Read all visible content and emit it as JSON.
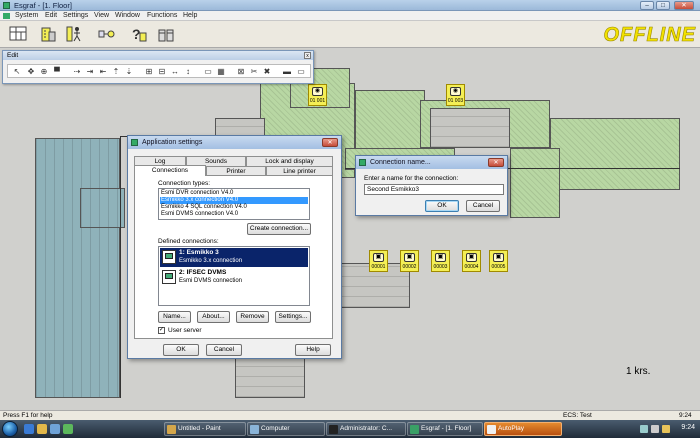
{
  "window": {
    "title": "Esgraf - [1. Floor]",
    "controls": {
      "minimize": "–",
      "maximize": "□",
      "close": "✕"
    }
  },
  "menubar": [
    "System",
    "Edit",
    "Settings",
    "View",
    "Window",
    "Functions",
    "Help"
  ],
  "toolbar_icons": [
    "floorplan-icon",
    "building-icon",
    "user-walk-icon",
    "key-icon",
    "help-icon",
    "toolbox-icon"
  ],
  "offline_label": "OFFLINE",
  "edit_toolbar": {
    "title": "Edit",
    "close": "x",
    "tools": [
      "↖",
      "✥",
      "⊕",
      "▀",
      "⇢",
      "⇥",
      "⇤",
      "⇡",
      "⇣",
      "⊞",
      "⊟",
      "↔",
      "↕",
      "▭",
      "▦",
      "⊠",
      "✂",
      "✖",
      "▬",
      "▭"
    ]
  },
  "devices": [
    {
      "id": "01 001",
      "glyph": "◉"
    },
    {
      "id": "01 003",
      "glyph": "◉"
    },
    {
      "id": "00001",
      "glyph": "▣"
    },
    {
      "id": "00002",
      "glyph": "▣"
    },
    {
      "id": "00003",
      "glyph": "▣"
    },
    {
      "id": "00004",
      "glyph": "▣"
    },
    {
      "id": "00005",
      "glyph": "▣"
    }
  ],
  "scale_label": "1 krs.",
  "app_settings": {
    "title": "Application settings",
    "tabs_row1": [
      "Log",
      "Sounds",
      "Lock and display"
    ],
    "tabs_row2": [
      "Connections",
      "Printer",
      "Line printer"
    ],
    "active_tab": "Connections",
    "connection_types_label": "Connection types:",
    "connection_types": [
      "Esmi DVR connection V4.0",
      "Esmikko 3.x connection V4.0",
      "Esmikko 4 SQL connection V4.0",
      "Esmi DVMS connection V4.0"
    ],
    "selected_type_index": 1,
    "create_button": "Create connection...",
    "defined_label": "Defined connections:",
    "defined_connections": [
      {
        "name": "1: Esmikko 3",
        "subtitle": "Esmikko 3.x connection"
      },
      {
        "name": "2: IFSEC DVMS",
        "subtitle": "Esmi DVMS connection"
      }
    ],
    "row_buttons": [
      "Name...",
      "About...",
      "Remove",
      "Settings..."
    ],
    "user_server_label": "User server",
    "user_server_checked": true,
    "footer_buttons": {
      "ok": "OK",
      "cancel": "Cancel",
      "help": "Help"
    }
  },
  "name_dialog": {
    "title": "Connection name...",
    "prompt": "Enter a name for the connection:",
    "value": "Second Esmikko3",
    "ok": "OK",
    "cancel": "Cancel"
  },
  "statusbar": {
    "left": "Press F1 for help",
    "middle": "ECS: Test",
    "right": "9:24"
  },
  "taskbar": {
    "tasks": [
      {
        "label": "Untitled - Paint",
        "color": "#d4a64a",
        "active": false
      },
      {
        "label": "Computer",
        "color": "#8ab4d8",
        "active": false
      },
      {
        "label": "Administrator: C...",
        "color": "#222222",
        "active": false
      },
      {
        "label": "Esgraf - [1. Floor]",
        "color": "#3aa066",
        "active": false
      },
      {
        "label": "AutoPlay",
        "color": "#f0f0f0",
        "active": true
      }
    ],
    "clock": "9:24"
  },
  "colors": {
    "device_yellow": "#f4ef55",
    "offline_yellow": "#f2e100",
    "green_zone": "#b8d7a3",
    "blue_zone": "#8fb2ba",
    "selection": "#0a246a"
  }
}
